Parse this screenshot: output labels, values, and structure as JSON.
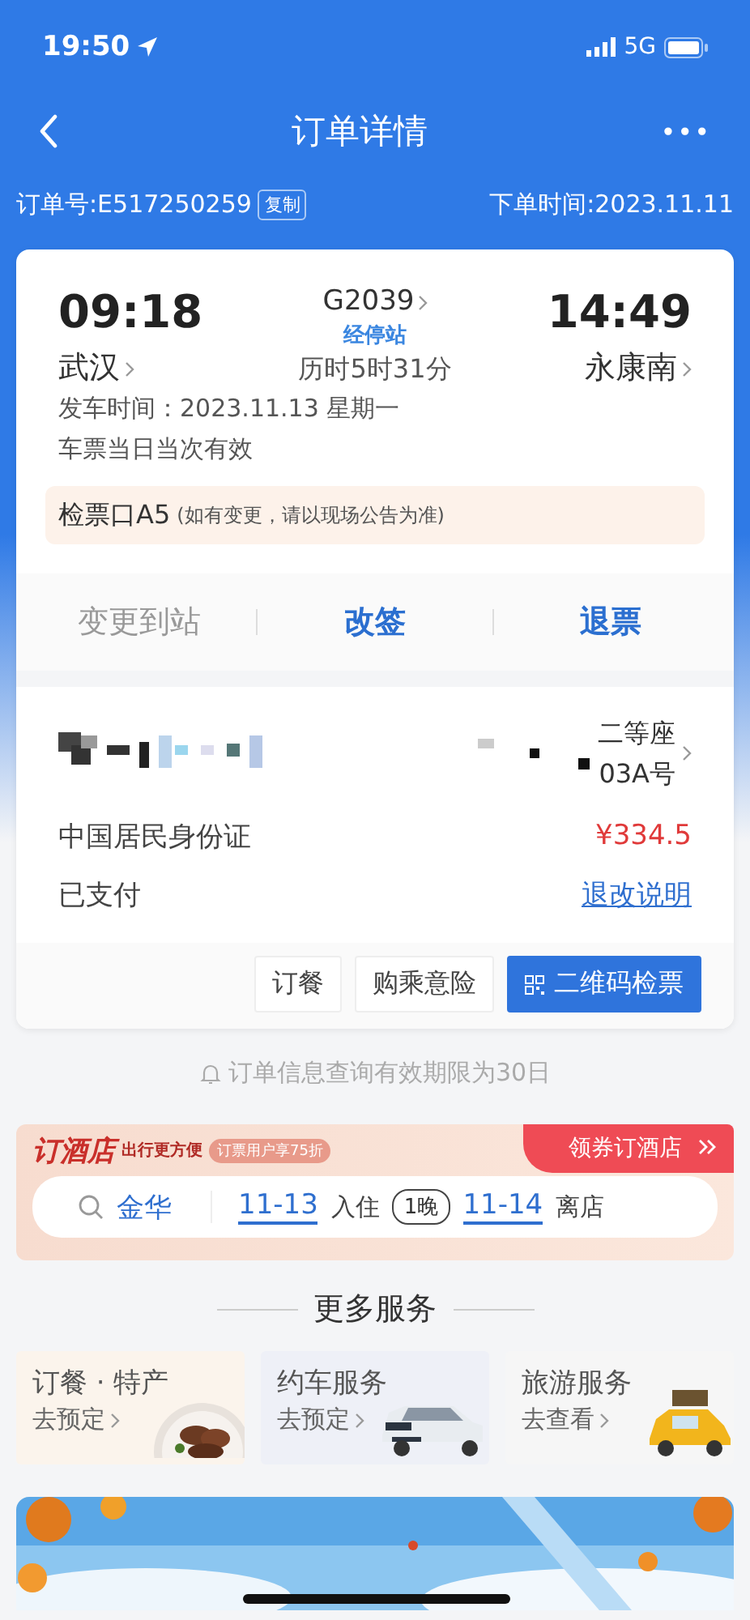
{
  "status_bar": {
    "time": "19:50",
    "network": "5G"
  },
  "nav": {
    "title": "订单详情",
    "more": "•••"
  },
  "order": {
    "number": "订单号:E517250259",
    "copy": "复制",
    "placed": "下单时间:2023.11.11"
  },
  "trip": {
    "depart_time": "09:18",
    "depart_station": "武汉",
    "train": "G2039",
    "stops": "经停站",
    "duration": "历时5时31分",
    "arrive_time": "14:49",
    "arrive_station": "永康南",
    "date": "发车时间：2023.11.13 星期一",
    "validity": "车票当日当次有效",
    "gate": "检票口A5",
    "gate_note": "(如有变更，请以现场公告为准)"
  },
  "actions": [
    {
      "label": "变更到站",
      "disabled": true
    },
    {
      "label": "改签",
      "disabled": false
    },
    {
      "label": "退票",
      "disabled": false
    }
  ],
  "passenger": {
    "seat_class": "二等座",
    "seat": "03A号",
    "id_type": "中国居民身份证",
    "price": "¥334.5",
    "payment": "已支付",
    "policy_link": "退改说明"
  },
  "buttons": [
    {
      "label": "订餐",
      "kind": "plain"
    },
    {
      "label": "购乘意险",
      "kind": "plain"
    },
    {
      "label": "二维码检票",
      "kind": "primary"
    }
  ],
  "notice": "订单信息查询有效期限为30日",
  "hotel": {
    "logo": "订酒店",
    "slogan": "出行更方便",
    "badge": "订票用户享75折",
    "coupon": "领券订酒店",
    "city": "金华",
    "checkin_date": "11-13",
    "checkin_label": "入住",
    "nights": "1晚",
    "checkout_date": "11-14",
    "checkout_label": "离店"
  },
  "more_services": {
    "title": "更多服务",
    "items": [
      {
        "title": "订餐 · 特产",
        "action": "去预定",
        "kind": "food"
      },
      {
        "title": "约车服务",
        "action": "去预定",
        "kind": "car"
      },
      {
        "title": "旅游服务",
        "action": "去查看",
        "kind": "travel"
      }
    ]
  }
}
